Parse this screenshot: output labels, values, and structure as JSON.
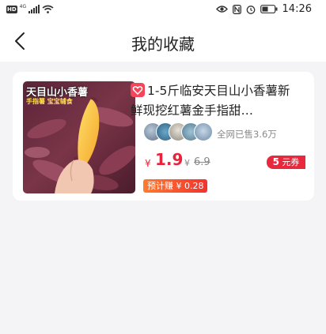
{
  "status_bar": {
    "network_badge": "HD",
    "network_type": "4G",
    "time": "14:26"
  },
  "header": {
    "title": "我的收藏"
  },
  "product": {
    "thumbnail_label": "天目山小香薯",
    "thumbnail_sub": "手指薯 宝宝辅食",
    "title": "1-5斤临安天目山小香薯新鲜现挖红薯金手指甜…",
    "sold_text": "全网已售3.6万",
    "currency": "¥",
    "price": "1.9",
    "original_currency": "¥",
    "original_price": "6.9",
    "coupon_amount": "5",
    "coupon_unit": "元券",
    "estimated_earning": "预计赚 ¥ 0.28"
  },
  "colors": {
    "accent": "#e6253a",
    "background": "#f4f4f6"
  }
}
